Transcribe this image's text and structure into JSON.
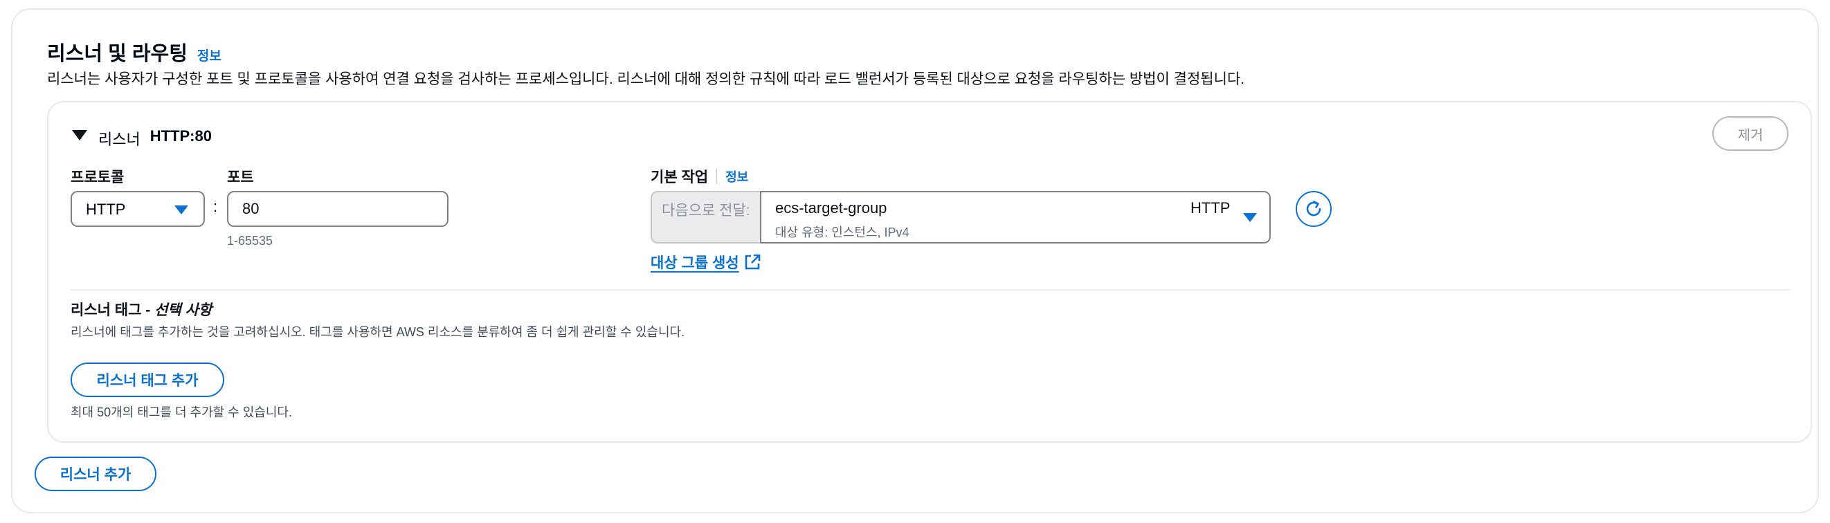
{
  "section": {
    "title": "리스너 및 라우팅",
    "info": "정보",
    "description": "리스너는 사용자가 구성한 포트 및 프로토콜을 사용하여 연결 요청을 검사하는 프로세스입니다. 리스너에 대해 정의한 규칙에 따라 로드 밸런서가 등록된 대상으로 요청을 라우팅하는 방법이 결정됩니다."
  },
  "listener": {
    "prefix": "리스너",
    "name": "HTTP:80",
    "remove_label": "제거",
    "protocol_label": "프로토콜",
    "protocol_value": "HTTP",
    "port_label": "포트",
    "colon": ":",
    "port_value": "80",
    "port_hint": "1-65535",
    "default_action_label": "기본 작업",
    "default_action_info": "정보",
    "forward_prefix": "다음으로 전달:",
    "target_group_name": "ecs-target-group",
    "target_group_sub": "대상 유형: 인스턴스, IPv4",
    "target_group_protocol": "HTTP",
    "create_target_group_link": "대상 그룹 생성",
    "tags_title": "리스너 태그 - ",
    "tags_optional": "선택 사항",
    "tags_description": "리스너에 태그를 추가하는 것을 고려하십시오. 태그를 사용하면 AWS 리소스를 분류하여 좀 더 쉽게 관리할 수 있습니다.",
    "add_tag_label": "리스너 태그 추가",
    "tag_limit_text": "최대 50개의 태그를 더 추가할 수 있습니다."
  },
  "add_listener_label": "리스너 추가",
  "colors": {
    "accent": "#0972d3",
    "border": "#7d8289",
    "disabled": "#8c929b"
  },
  "icons": {
    "caret": "caret-down-icon",
    "dropdown": "triangle-down-icon",
    "refresh": "refresh-icon",
    "external": "external-link-icon"
  }
}
